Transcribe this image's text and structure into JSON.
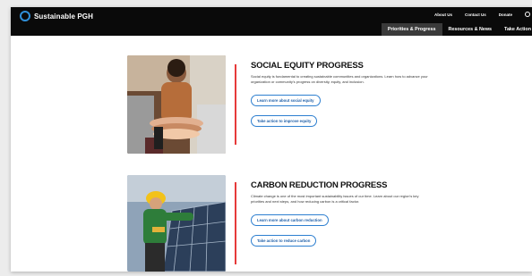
{
  "brand": {
    "name": "Sustainable PGH"
  },
  "utility_nav": [
    "About Us",
    "Contact Us",
    "Donate"
  ],
  "main_nav": [
    {
      "label": "Priorities & Progress",
      "active": true
    },
    {
      "label": "Resources & News",
      "active": false
    },
    {
      "label": "Take Action",
      "active": false
    }
  ],
  "sections": [
    {
      "title": "SOCIAL EQUITY PROGRESS",
      "body": "Social equity is fundamental to creating sustainable communities and organizations. Learn how to advance your organization or community's progress on diversity, equity, and inclusion.",
      "buttons": [
        "Learn more about social equity",
        "Take action to improve equity"
      ],
      "image_icon": "stacked-hands-photo"
    },
    {
      "title": "CARBON REDUCTION PROGRESS",
      "body": "Climate change is one of the most important sustainability issues of our time. Learn about our region's key priorities and next steps, and how reducing carbon is a critical factor.",
      "buttons": [
        "Learn more about carbon reduction",
        "Take action to reduce carbon"
      ],
      "image_icon": "solar-panel-worker-photo"
    }
  ],
  "colors": {
    "accent_blue": "#2d7fd0",
    "divider_red": "#e63a3a",
    "topbar": "#0a0a0a"
  }
}
